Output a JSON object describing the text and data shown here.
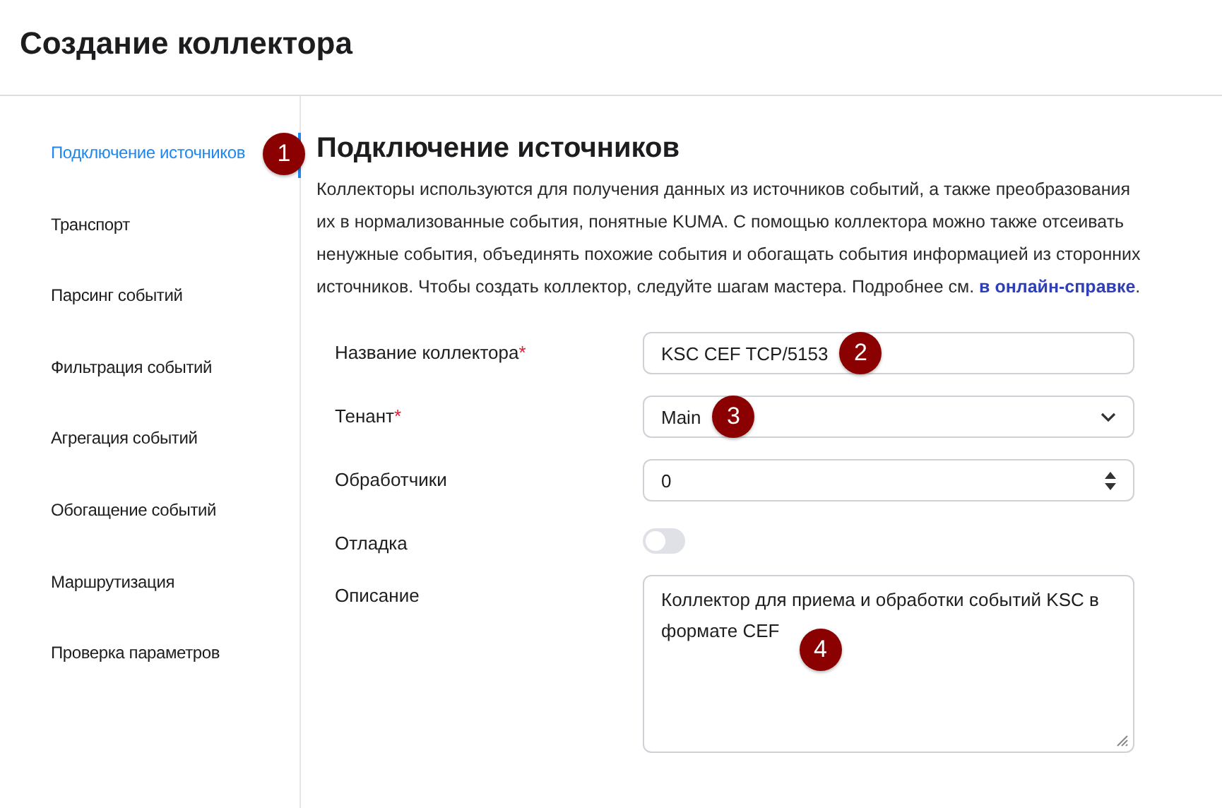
{
  "page": {
    "title": "Создание коллектора"
  },
  "steps": [
    {
      "label": "Подключение источников",
      "selected": true,
      "callout": "1"
    },
    {
      "label": "Транспорт",
      "selected": false
    },
    {
      "label": "Парсинг событий",
      "selected": false
    },
    {
      "label": "Фильтрация событий",
      "selected": false
    },
    {
      "label": "Агрегация событий",
      "selected": false
    },
    {
      "label": "Обогащение событий",
      "selected": false
    },
    {
      "label": "Маршрутизация",
      "selected": false
    },
    {
      "label": "Проверка параметров",
      "selected": false
    }
  ],
  "section": {
    "heading": "Подключение источников",
    "description": "Коллекторы используются для получения данных из источников событий, а также преобразования их в нормализованные события, понятные KUMA. С помощью коллектора можно также отсеивать ненужные события, объединять похожие события и обогащать события информацией из сторонних источников. Чтобы создать коллектор, следуйте шагам мастера. Подробнее см.",
    "link": "в онлайн-справке",
    "after_link": "."
  },
  "fields": [
    {
      "kind": "text",
      "label": "Название коллектора",
      "required_mark": "*",
      "value": "KSC CEF TCP/5153",
      "callout": "2"
    },
    {
      "kind": "select",
      "label": "Тенант",
      "required_mark": "*",
      "value": "Main",
      "callout": "3"
    },
    {
      "kind": "number",
      "label": "Обработчики",
      "value": "0"
    },
    {
      "kind": "toggle",
      "label": "Отладка",
      "on": false
    },
    {
      "kind": "textarea",
      "label": "Описание",
      "value": "Коллектор для приема и обработки событий KSC в формате CEF",
      "callout": "4"
    }
  ]
}
